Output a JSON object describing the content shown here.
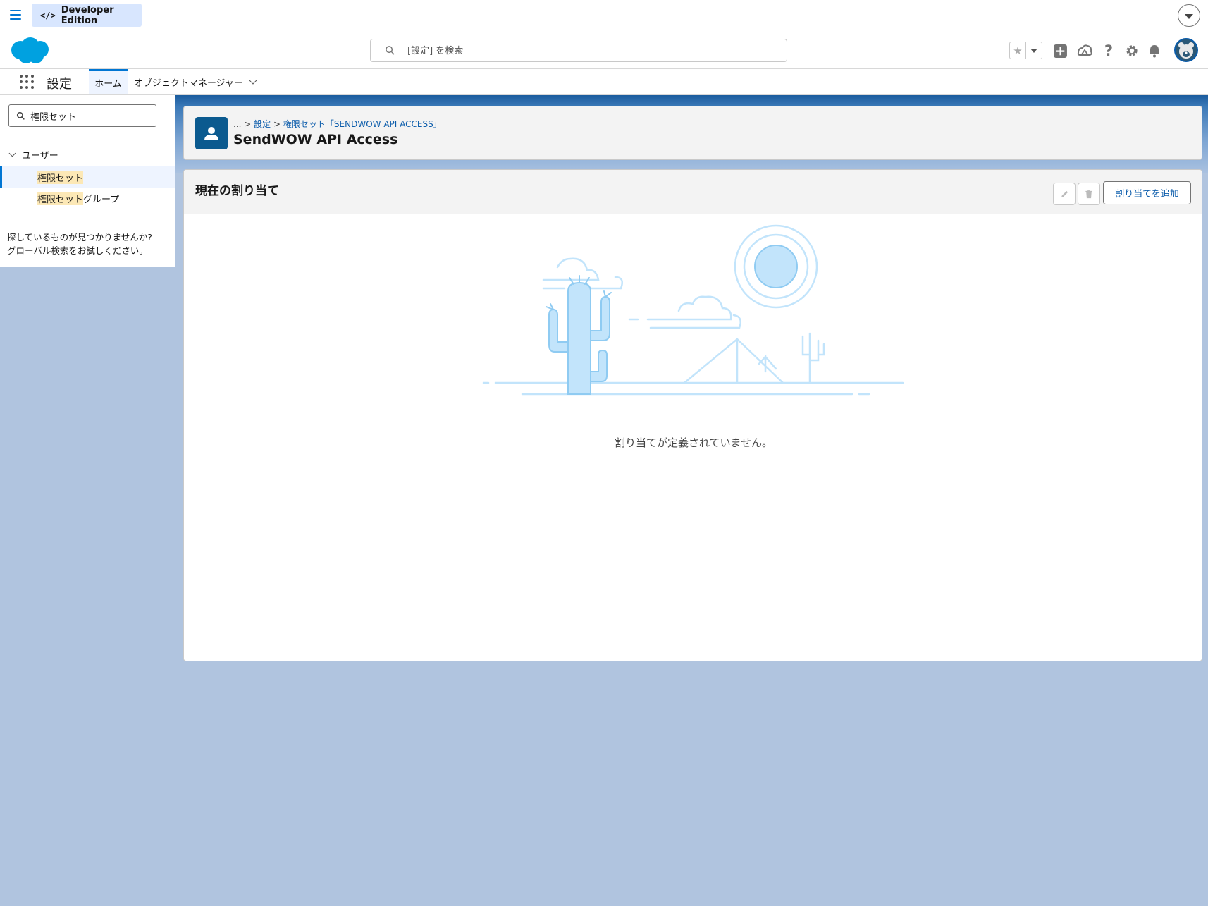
{
  "devbar": {
    "edition_label": "Developer Edition",
    "edition_icon": "code-icon"
  },
  "header": {
    "search_placeholder": "[設定] を検索",
    "icons": [
      "favorites-star-icon",
      "add-icon",
      "trailhead-icon",
      "help-icon",
      "gear-icon",
      "bell-icon",
      "avatar"
    ]
  },
  "appnav": {
    "app_name": "設定",
    "tabs": [
      {
        "label": "ホーム",
        "active": true
      },
      {
        "label": "オブジェクトマネージャー",
        "active": false
      }
    ]
  },
  "sidebar": {
    "quickfind_value": "権限セット",
    "parent": "ユーザー",
    "items": [
      {
        "highlight": "権限セット",
        "rest": "",
        "active": true
      },
      {
        "highlight": "権限セット",
        "rest": "グループ",
        "active": false
      }
    ],
    "notfound_line1": "探しているものが見つかりませんか?",
    "notfound_line2": "グローバル検索をお試しください。"
  },
  "page_header": {
    "crumb_ellipsis": "...",
    "crumb_sep": ">",
    "crumb_setup": "設定",
    "crumb_permset": "権限セット「SENDWOW API ACCESS」",
    "title": "SendWOW API Access"
  },
  "card": {
    "title": "現在の割り当て",
    "add_button": "割り当てを追加",
    "empty_message": "割り当てが定義されていません。"
  },
  "colors": {
    "brand": "#0176d3",
    "link": "#0b5cab",
    "background": "#b0c4df",
    "illustration": "#c2e4fb"
  }
}
